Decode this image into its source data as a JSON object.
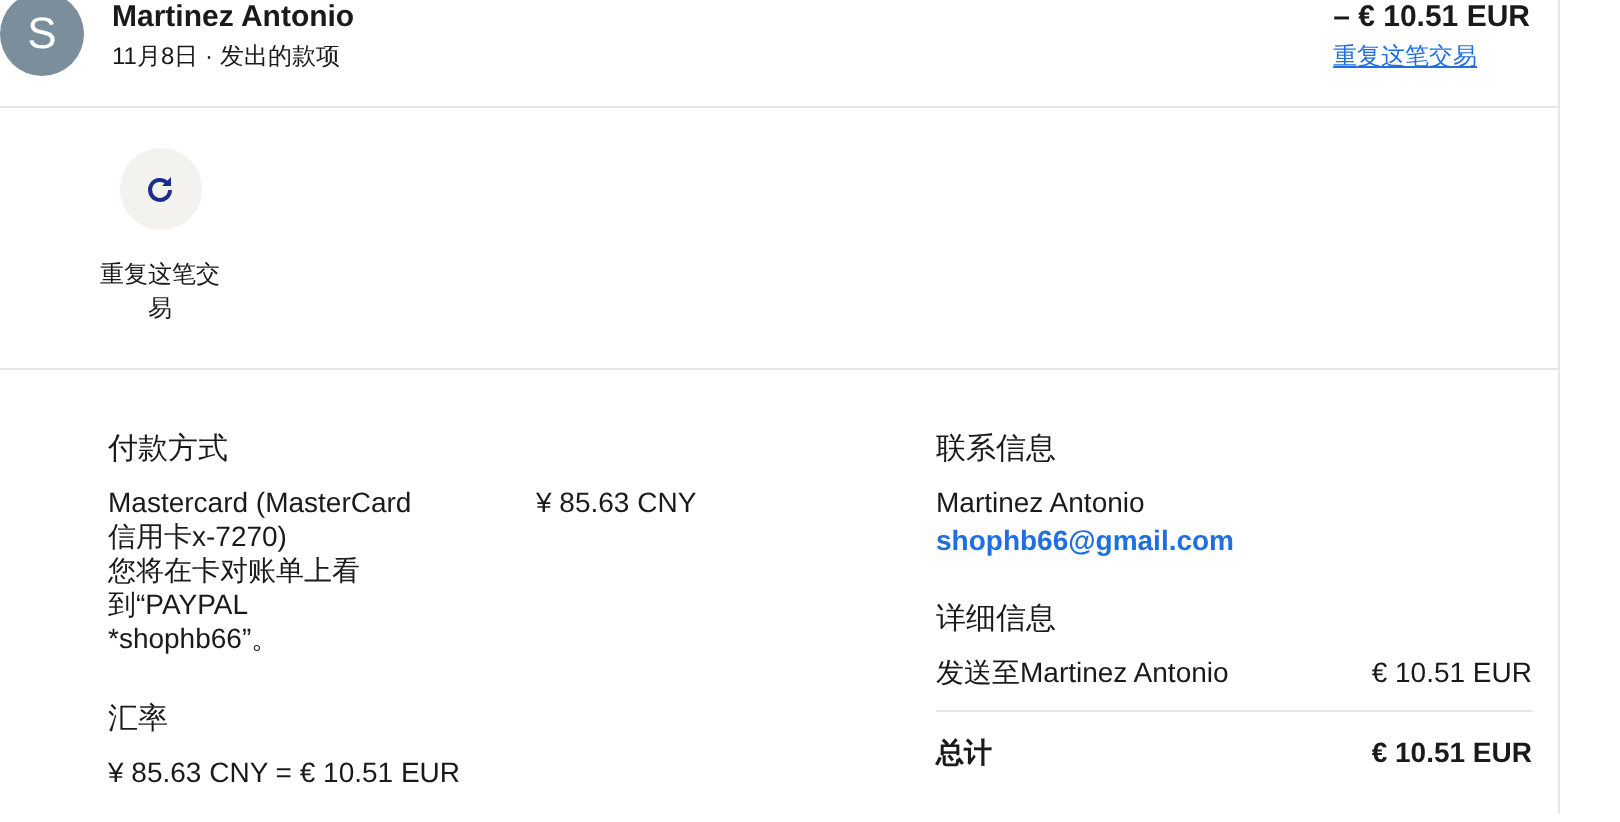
{
  "header": {
    "avatar": "S",
    "name": "Martinez Antonio",
    "subtitle": "11月8日 · 发出的款项",
    "amount": "– € 10.51 EUR",
    "repeat_link": "重复这笔交易"
  },
  "actions": [
    {
      "label": "重复这笔交易"
    }
  ],
  "payment": {
    "title": "付款方式",
    "card": "Mastercard (MasterCard信用卡x-7270)",
    "note": "您将在卡对账单上看到“PAYPAL *shophb66”。",
    "amount": "¥ 85.63 CNY"
  },
  "exchange": {
    "title": "汇率",
    "rate": "¥ 85.63 CNY = € 10.51 EUR"
  },
  "contact": {
    "title": "联系信息",
    "name": "Martinez Antonio",
    "email": "shophb66@gmail.com"
  },
  "details": {
    "title": "详细信息",
    "rows": [
      {
        "label": "发送至Martinez Antonio",
        "value": "€ 10.51 EUR"
      }
    ],
    "total_label": "总计",
    "total_value": "€ 10.51 EUR"
  }
}
